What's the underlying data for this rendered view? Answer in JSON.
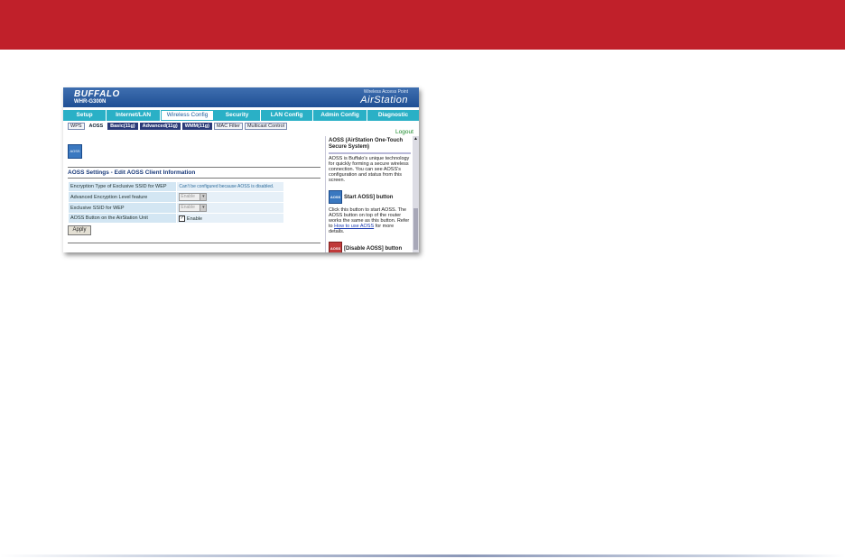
{
  "router": {
    "brand": "BUFFALO",
    "model": "WHR-G300N",
    "product_line_top": "Wireless Access Point",
    "product_name": "AirStation"
  },
  "main_tabs": [
    {
      "label": "Setup",
      "active": false
    },
    {
      "label": "Internet/LAN",
      "active": false
    },
    {
      "label": "Wireless Config",
      "active": true
    },
    {
      "label": "Security",
      "active": false
    },
    {
      "label": "LAN Config",
      "active": false
    },
    {
      "label": "Admin Config",
      "active": false
    },
    {
      "label": "Diagnostic",
      "active": false
    }
  ],
  "sub_tabs": [
    {
      "label": "WPS"
    },
    {
      "label": "AOSS"
    },
    {
      "label": "Basic(11g)"
    },
    {
      "label": "Advanced(11g)"
    },
    {
      "label": "WMM(11g)"
    },
    {
      "label": "MAC Filter"
    },
    {
      "label": "Multicast Control"
    }
  ],
  "logout_label": "Logout",
  "aoss_icon_text": "AOSS",
  "section_title": "AOSS Settings - Edit AOSS Client Information",
  "settings_rows": [
    {
      "label": "Encryption Type of Exclusive SSID for WEP",
      "value": "Can't be configured because AOSS is disabled."
    },
    {
      "label": "Advanced Encryption Level feature",
      "value": "Enable"
    },
    {
      "label": "Exclusive SSID for WEP",
      "value": "Enable"
    },
    {
      "label": "AOSS Button on the AirStation Unit",
      "value": "Enable",
      "checked": true
    }
  ],
  "apply_label": "Apply",
  "help": {
    "title": "AOSS (AirStation One-Touch Secure System)",
    "description": "AOSS is Buffalo's unique technology for quickly forming a secure wireless connection. You can see AOSS's configuration and status from this screen.",
    "start_label": "Start AOSS] button",
    "start_desc_1": "Click this button to start AOSS. The AOSS button on top of the router works the same as this button. Refer to",
    "start_link": "How to use AOSS",
    "start_desc_2": "for more details.",
    "disable_label": "[Disable AOSS] button",
    "start_icon_text": "AOSS",
    "disable_icon_text": "AOSS"
  },
  "colors": {
    "top_bar": "#c0202a",
    "header_blue": "#1f4f94",
    "tab_teal": "#2ab0c6",
    "row_blue": "#d3e6f3",
    "logout_green": "#1a8a2a"
  }
}
